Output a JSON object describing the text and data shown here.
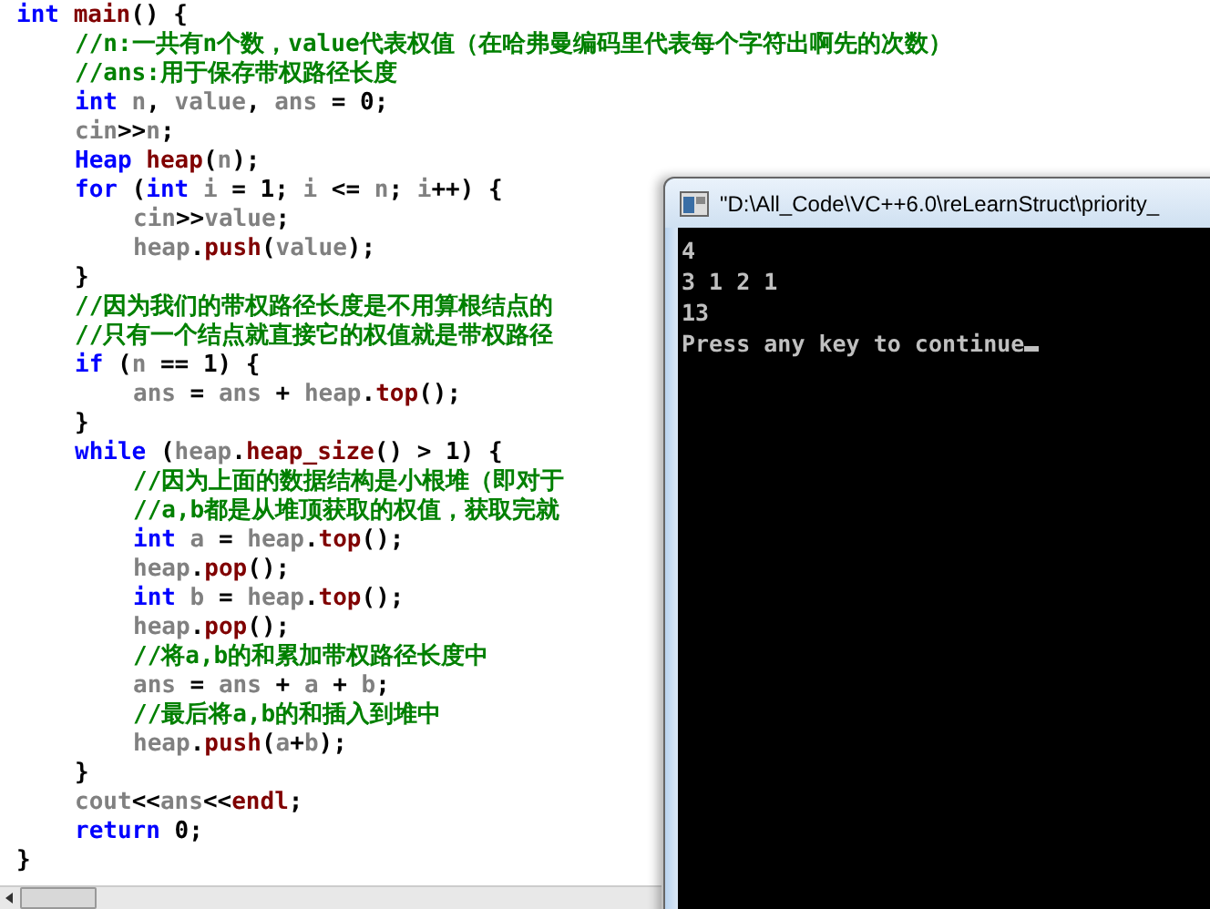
{
  "editor": {
    "lines": [
      {
        "tokens": [
          {
            "kind": "kw",
            "t": "int "
          },
          {
            "kind": "fn",
            "t": "main"
          },
          {
            "kind": "p",
            "t": "() {"
          }
        ],
        "children": [
          {
            "tokens": [
              {
                "kind": "cm",
                "t": "//n:一共有n个数，value代表权值（在哈弗曼编码里代表每个字符出啊先的次数）"
              }
            ]
          },
          {
            "tokens": [
              {
                "kind": "cm",
                "t": "//ans:用于保存带权路径长度"
              }
            ]
          },
          {
            "tokens": [
              {
                "kind": "kw",
                "t": "int"
              },
              {
                "kind": "id",
                "t": " n"
              },
              {
                "kind": "p",
                "t": ", "
              },
              {
                "kind": "id",
                "t": "value"
              },
              {
                "kind": "p",
                "t": ", "
              },
              {
                "kind": "id",
                "t": "ans"
              },
              {
                "kind": "p",
                "t": " = 0;"
              }
            ]
          },
          {
            "tokens": [
              {
                "kind": "id",
                "t": "cin"
              },
              {
                "kind": "p",
                "t": ">>"
              },
              {
                "kind": "id",
                "t": "n"
              },
              {
                "kind": "p",
                "t": ";"
              }
            ]
          },
          {
            "tokens": [
              {
                "kind": "kw",
                "t": "Heap "
              },
              {
                "kind": "fn",
                "t": "heap"
              },
              {
                "kind": "p",
                "t": "("
              },
              {
                "kind": "id",
                "t": "n"
              },
              {
                "kind": "p",
                "t": ");"
              }
            ]
          },
          {
            "tokens": [
              {
                "kind": "kw",
                "t": "for"
              },
              {
                "kind": "p",
                "t": " ("
              },
              {
                "kind": "kw",
                "t": "int"
              },
              {
                "kind": "id",
                "t": " i"
              },
              {
                "kind": "p",
                "t": " = 1; "
              },
              {
                "kind": "id",
                "t": "i"
              },
              {
                "kind": "p",
                "t": " <= "
              },
              {
                "kind": "id",
                "t": "n"
              },
              {
                "kind": "p",
                "t": "; "
              },
              {
                "kind": "id",
                "t": "i"
              },
              {
                "kind": "p",
                "t": "++) {"
              }
            ],
            "children": [
              {
                "tokens": [
                  {
                    "kind": "id",
                    "t": "cin"
                  },
                  {
                    "kind": "p",
                    "t": ">>"
                  },
                  {
                    "kind": "id",
                    "t": "value"
                  },
                  {
                    "kind": "p",
                    "t": ";"
                  }
                ]
              },
              {
                "tokens": [
                  {
                    "kind": "id",
                    "t": "heap"
                  },
                  {
                    "kind": "p",
                    "t": "."
                  },
                  {
                    "kind": "fn",
                    "t": "push"
                  },
                  {
                    "kind": "p",
                    "t": "("
                  },
                  {
                    "kind": "id",
                    "t": "value"
                  },
                  {
                    "kind": "p",
                    "t": ");"
                  }
                ]
              }
            ]
          },
          {
            "tokens": [
              {
                "kind": "p",
                "t": "}"
              }
            ]
          },
          {
            "tokens": [
              {
                "kind": "cm",
                "t": "//因为我们的带权路径长度是不用算根结点的"
              }
            ]
          },
          {
            "tokens": [
              {
                "kind": "cm",
                "t": "//只有一个结点就直接它的权值就是带权路径"
              }
            ]
          },
          {
            "tokens": [
              {
                "kind": "kw",
                "t": "if"
              },
              {
                "kind": "p",
                "t": " ("
              },
              {
                "kind": "id",
                "t": "n"
              },
              {
                "kind": "p",
                "t": " == 1) {"
              }
            ],
            "children": [
              {
                "tokens": [
                  {
                    "kind": "id",
                    "t": "ans"
                  },
                  {
                    "kind": "p",
                    "t": " = "
                  },
                  {
                    "kind": "id",
                    "t": "ans"
                  },
                  {
                    "kind": "p",
                    "t": " + "
                  },
                  {
                    "kind": "id",
                    "t": "heap"
                  },
                  {
                    "kind": "p",
                    "t": "."
                  },
                  {
                    "kind": "fn",
                    "t": "top"
                  },
                  {
                    "kind": "p",
                    "t": "();"
                  }
                ]
              }
            ]
          },
          {
            "tokens": [
              {
                "kind": "p",
                "t": "}"
              }
            ]
          },
          {
            "tokens": [
              {
                "kind": "kw",
                "t": "while"
              },
              {
                "kind": "p",
                "t": " ("
              },
              {
                "kind": "id",
                "t": "heap"
              },
              {
                "kind": "p",
                "t": "."
              },
              {
                "kind": "fn",
                "t": "heap_size"
              },
              {
                "kind": "p",
                "t": "() > 1) {"
              }
            ],
            "children": [
              {
                "tokens": [
                  {
                    "kind": "cm",
                    "t": "//因为上面的数据结构是小根堆（即对于"
                  }
                ]
              },
              {
                "tokens": [
                  {
                    "kind": "cm",
                    "t": "//a,b都是从堆顶获取的权值，获取完就"
                  }
                ]
              },
              {
                "tokens": [
                  {
                    "kind": "kw",
                    "t": "int"
                  },
                  {
                    "kind": "id",
                    "t": " a"
                  },
                  {
                    "kind": "p",
                    "t": " = "
                  },
                  {
                    "kind": "id",
                    "t": "heap"
                  },
                  {
                    "kind": "p",
                    "t": "."
                  },
                  {
                    "kind": "fn",
                    "t": "top"
                  },
                  {
                    "kind": "p",
                    "t": "();"
                  }
                ]
              },
              {
                "tokens": [
                  {
                    "kind": "id",
                    "t": "heap"
                  },
                  {
                    "kind": "p",
                    "t": "."
                  },
                  {
                    "kind": "fn",
                    "t": "pop"
                  },
                  {
                    "kind": "p",
                    "t": "();"
                  }
                ]
              },
              {
                "tokens": [
                  {
                    "kind": "kw",
                    "t": "int"
                  },
                  {
                    "kind": "id",
                    "t": " b"
                  },
                  {
                    "kind": "p",
                    "t": " = "
                  },
                  {
                    "kind": "id",
                    "t": "heap"
                  },
                  {
                    "kind": "p",
                    "t": "."
                  },
                  {
                    "kind": "fn",
                    "t": "top"
                  },
                  {
                    "kind": "p",
                    "t": "();"
                  }
                ]
              },
              {
                "tokens": [
                  {
                    "kind": "id",
                    "t": "heap"
                  },
                  {
                    "kind": "p",
                    "t": "."
                  },
                  {
                    "kind": "fn",
                    "t": "pop"
                  },
                  {
                    "kind": "p",
                    "t": "();"
                  }
                ]
              },
              {
                "tokens": [
                  {
                    "kind": "cm",
                    "t": "//将a,b的和累加带权路径长度中"
                  }
                ]
              },
              {
                "tokens": [
                  {
                    "kind": "id",
                    "t": "ans"
                  },
                  {
                    "kind": "p",
                    "t": " = "
                  },
                  {
                    "kind": "id",
                    "t": "ans"
                  },
                  {
                    "kind": "p",
                    "t": " + "
                  },
                  {
                    "kind": "id",
                    "t": "a"
                  },
                  {
                    "kind": "p",
                    "t": " + "
                  },
                  {
                    "kind": "id",
                    "t": "b"
                  },
                  {
                    "kind": "p",
                    "t": ";"
                  }
                ]
              },
              {
                "tokens": [
                  {
                    "kind": "cm",
                    "t": "//最后将a,b的和插入到堆中"
                  }
                ]
              },
              {
                "tokens": [
                  {
                    "kind": "id",
                    "t": "heap"
                  },
                  {
                    "kind": "p",
                    "t": "."
                  },
                  {
                    "kind": "fn",
                    "t": "push"
                  },
                  {
                    "kind": "p",
                    "t": "("
                  },
                  {
                    "kind": "id",
                    "t": "a"
                  },
                  {
                    "kind": "p",
                    "t": "+"
                  },
                  {
                    "kind": "id",
                    "t": "b"
                  },
                  {
                    "kind": "p",
                    "t": ");"
                  }
                ]
              }
            ]
          },
          {
            "tokens": [
              {
                "kind": "p",
                "t": "}"
              }
            ]
          },
          {
            "tokens": [
              {
                "kind": "id",
                "t": "cout"
              },
              {
                "kind": "p",
                "t": "<<"
              },
              {
                "kind": "id",
                "t": "ans"
              },
              {
                "kind": "p",
                "t": "<<"
              },
              {
                "kind": "fn",
                "t": "endl"
              },
              {
                "kind": "p",
                "t": ";"
              }
            ]
          },
          {
            "tokens": [
              {
                "kind": "kw",
                "t": "return"
              },
              {
                "kind": "p",
                "t": " 0;"
              }
            ]
          }
        ]
      },
      {
        "tokens": [
          {
            "kind": "p",
            "t": "}"
          }
        ]
      }
    ]
  },
  "console": {
    "title": "\"D:\\All_Code\\VC++6.0\\reLearnStruct\\priority_",
    "lines": [
      "4",
      "3 1 2 1",
      "13",
      "Press any key to continue"
    ]
  }
}
